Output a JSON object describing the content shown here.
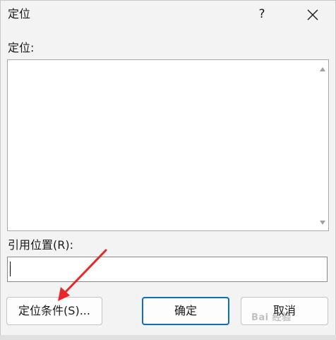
{
  "dialog": {
    "title": "定位",
    "help_label": "?",
    "close_icon": "close-icon"
  },
  "goto": {
    "label": "定位:",
    "items": []
  },
  "reference": {
    "label": "引用位置(R):",
    "value": ""
  },
  "buttons": {
    "special": "定位条件(S)...",
    "ok": "确定",
    "cancel": "取消"
  },
  "colors": {
    "background": "#f3f3f3",
    "primary_border": "#0f6cbd",
    "annotation_arrow": "#e8272a"
  },
  "watermark": "Bai 经验"
}
